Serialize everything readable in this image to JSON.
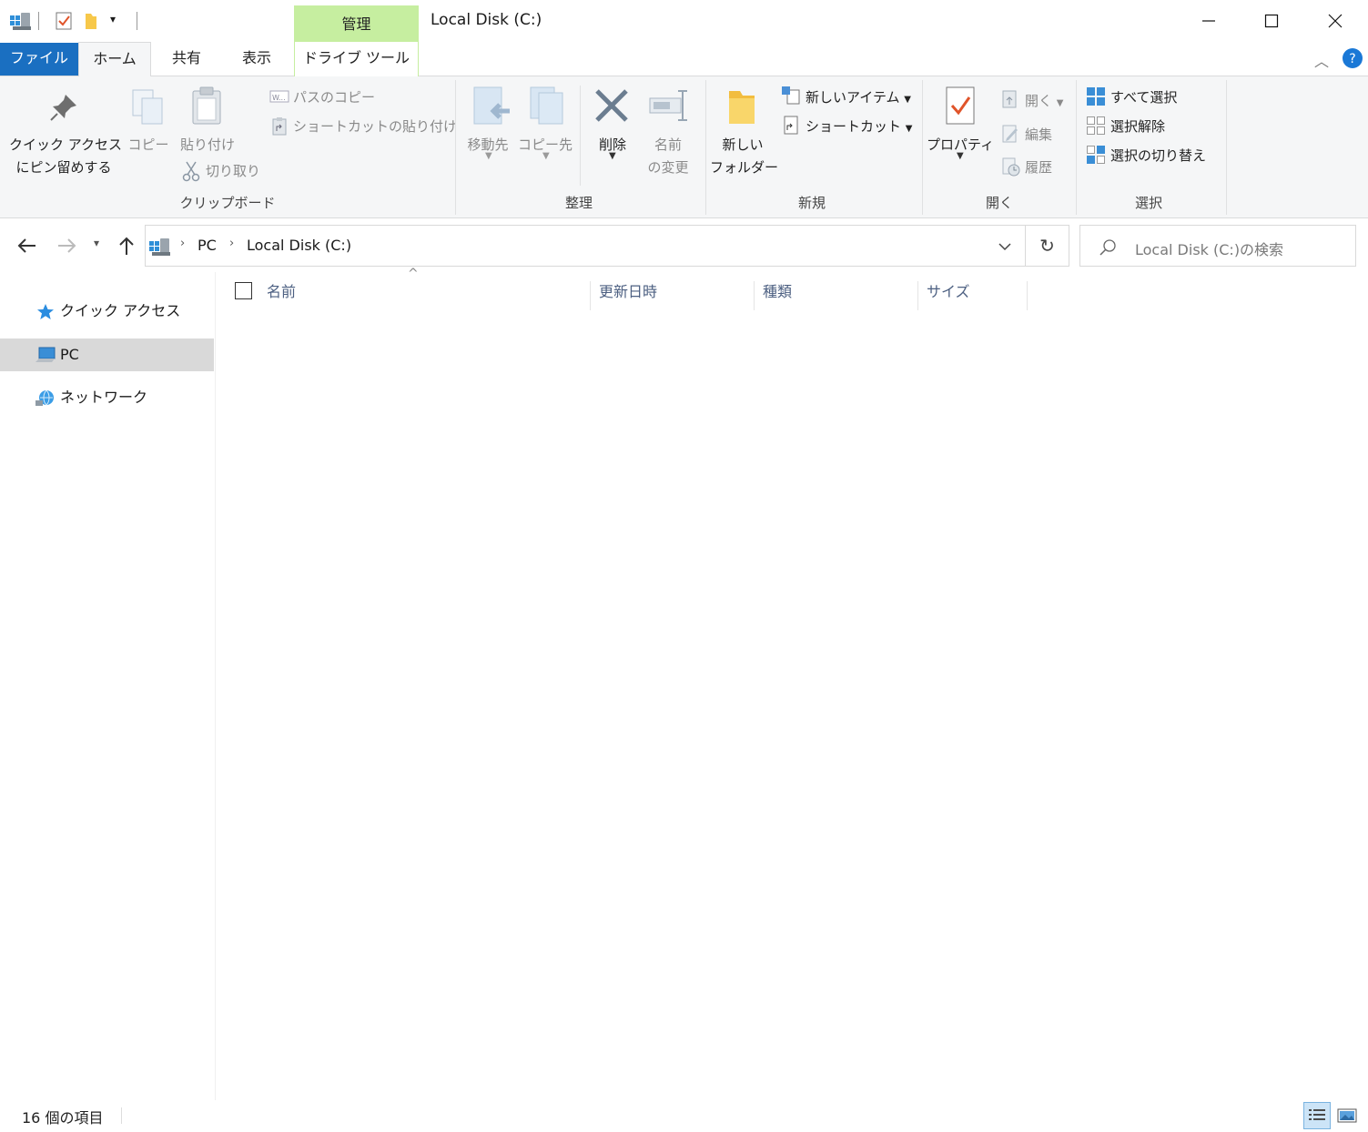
{
  "window": {
    "title": "Local Disk (C:)",
    "context_tab_group": "管理",
    "caption": {
      "minimize": "—",
      "maximize": "☐",
      "close": "✕"
    }
  },
  "tabs": [
    {
      "label": "ファイル"
    },
    {
      "label": "ホーム"
    },
    {
      "label": "共有"
    },
    {
      "label": "表示"
    },
    {
      "label": "ドライブ ツール"
    }
  ],
  "ribbon": {
    "clipboard": {
      "group": "クリップボード",
      "pin_line1": "クイック アクセス",
      "pin_line2": "にピン留めする",
      "copy": "コピー",
      "paste": "貼り付け",
      "copy_path": "パスのコピー",
      "paste_shortcut": "ショートカットの貼り付け",
      "cut": "切り取り"
    },
    "organize": {
      "group": "整理",
      "move_to": "移動先",
      "copy_to": "コピー先",
      "delete": "削除",
      "rename_line1": "名前",
      "rename_line2": "の変更"
    },
    "new": {
      "group": "新規",
      "folder_line1": "新しい",
      "folder_line2": "フォルダー",
      "new_item": "新しいアイテム",
      "shortcut": "ショートカット"
    },
    "open": {
      "group": "開く",
      "properties": "プロパティ",
      "open": "開く",
      "edit": "編集",
      "history": "履歴"
    },
    "select": {
      "group": "選択",
      "all": "すべて選択",
      "none": "選択解除",
      "invert": "選択の切り替え"
    }
  },
  "address": {
    "crumbs": [
      "PC",
      "Local Disk (C:)"
    ],
    "search_placeholder": "Local Disk (C:)の検索"
  },
  "nav": {
    "items": [
      {
        "label": "クイック アクセス"
      },
      {
        "label": "PC"
      },
      {
        "label": "ネットワーク"
      }
    ]
  },
  "columns": [
    "名前",
    "更新日時",
    "種類",
    "サイズ"
  ],
  "status": {
    "count": "16 個の項目"
  },
  "colors": {
    "file_tab": "#1a6fc1",
    "context_tab": "#c6eea0",
    "ribbon_bg": "#f5f6f7"
  }
}
